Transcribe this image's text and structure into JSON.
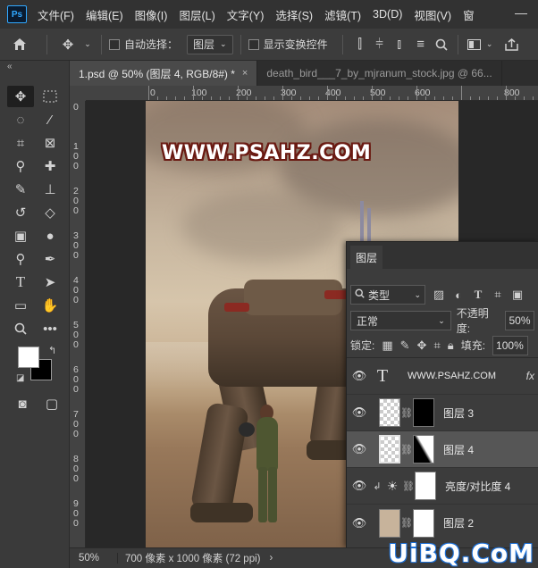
{
  "app": {
    "logo": "Ps",
    "menus": [
      "文件(F)",
      "编辑(E)",
      "图像(I)",
      "图层(L)",
      "文字(Y)",
      "选择(S)",
      "滤镜(T)",
      "3D(D)",
      "视图(V)",
      "窗"
    ]
  },
  "options_bar": {
    "auto_select_label": "自动选择：",
    "auto_select_value": "图层",
    "show_transform_label": "显示变换控件"
  },
  "tabs": [
    {
      "label": "1.psd @ 50% (图层 4, RGB/8#) *",
      "close": "×"
    },
    {
      "label": "death_bird___7_by_mjranum_stock.jpg @ 66..."
    }
  ],
  "rulers": {
    "top": [
      "0",
      "100",
      "200",
      "300",
      "400",
      "500",
      "600",
      "800"
    ],
    "left": [
      "0",
      "1\n0\n0",
      "2\n0\n0",
      "3\n0\n0",
      "4\n0\n0",
      "5\n0\n0",
      "6\n0\n0",
      "7\n0\n0",
      "8\n0\n0",
      "9\n0\n0"
    ]
  },
  "canvas": {
    "watermark": "WWW.PSAHZ.COM"
  },
  "layers_panel": {
    "tab_label": "图层",
    "filter_kind": "类型",
    "blend_mode": "正常",
    "opacity_label": "不透明度:",
    "opacity_value": "50%",
    "lock_label": "锁定:",
    "fill_label": "填充:",
    "fill_value": "100%",
    "layers": [
      {
        "name": "WWW.PSAHZ.COM",
        "type": "text",
        "fx": "fx"
      },
      {
        "name": "图层 3",
        "type": "pixel",
        "mask": "black"
      },
      {
        "name": "图层 4",
        "type": "pixel",
        "mask": "gradient",
        "selected": true
      },
      {
        "name": "亮度/对比度 4",
        "type": "adjustment",
        "mask": "white"
      },
      {
        "name": "图层 2",
        "type": "pixel",
        "mask": "white"
      }
    ]
  },
  "status": {
    "zoom": "50%",
    "doc_info": "700 像素 x 1000 像素 (72 ppi)"
  },
  "site_watermark": "UiBQ.CoM",
  "colors": {
    "foreground": "#ffffff",
    "background": "#000000",
    "accent": "#31a8ff"
  }
}
